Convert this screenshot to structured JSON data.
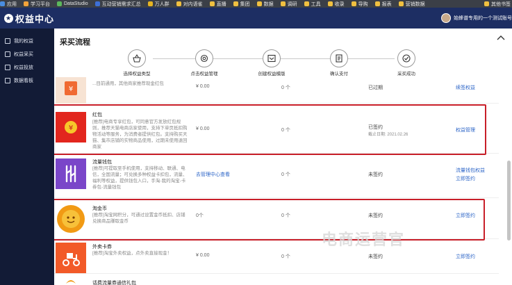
{
  "bookmarks": [
    {
      "label": "应用",
      "color": "#4a8de0"
    },
    {
      "label": "学习平台",
      "color": "#f2a33a"
    },
    {
      "label": "DataStudio",
      "color": "#5cb85c"
    },
    {
      "label": "互动营销需求汇总",
      "color": "#3d6fd6"
    },
    {
      "label": "万人群",
      "color": "#e6b422"
    },
    {
      "label": "对内语雀",
      "color": "#f0c040"
    },
    {
      "label": "直播",
      "color": "#f0c040"
    },
    {
      "label": "集团",
      "color": "#f0c040"
    },
    {
      "label": "数据",
      "color": "#f0c040"
    },
    {
      "label": "调研",
      "color": "#f0c040"
    },
    {
      "label": "工具",
      "color": "#f0c040"
    },
    {
      "label": "收录",
      "color": "#f0c040"
    },
    {
      "label": "导购",
      "color": "#f0c040"
    },
    {
      "label": "报表",
      "color": "#f0c040"
    },
    {
      "label": "营销数据",
      "color": "#f0c040"
    }
  ],
  "bookmarks_other": "其他书签",
  "app": {
    "title": "权益中心",
    "user": "始蜂谱专用的一个测试账号"
  },
  "sidebar": {
    "items": [
      {
        "label": "我的权益"
      },
      {
        "label": "权益采买"
      },
      {
        "label": "权益投放"
      },
      {
        "label": "数据看板"
      }
    ]
  },
  "main": {
    "title": "采买流程",
    "steps": [
      {
        "label": "选择权益类型",
        "icon": "basket-icon"
      },
      {
        "label": "点击权益管理",
        "icon": "gear-icon"
      },
      {
        "label": "创建权益模版",
        "icon": "template-icon"
      },
      {
        "label": "确认支付",
        "icon": "document-icon"
      },
      {
        "label": "采买成功",
        "icon": "check-icon"
      }
    ],
    "rows": [
      {
        "name": "",
        "desc": "...目前通用，其他商家推荐现金红包",
        "price": "¥ 0.00",
        "count": "0 个",
        "status": "已过期",
        "status_sub": "",
        "mid_link": "",
        "links": [
          "续签权益"
        ]
      },
      {
        "name": "红包",
        "desc": "[推荐]电商专享红包，可同意官方发放红包规则，推荐天猫电商店家使用，支持下单页抵扣购物活动等服务，为消费者提供红包。支持购买天猫、集市店铺的实物商品使用，过期未使用退回商家",
        "price": "¥ 0.00",
        "count": "0 个",
        "status": "已签约",
        "status_sub": "截止日期: 2021.02.26",
        "mid_link": "",
        "links": [
          "权益管理"
        ]
      },
      {
        "name": "流量钱包",
        "desc": "[推荐]可提取至手机使用，支持移动、联通、电信，全国流量；可兑换多种权益卡扣包，流量、福利等权益，提供钱包入口，手淘-我的淘宝-卡券包-流量钱包",
        "price": "",
        "count": "0 个",
        "status": "未签约",
        "status_sub": "",
        "mid_link": "去管理中心查看",
        "links": [
          "流量钱包权益",
          "立即签约"
        ]
      },
      {
        "name": "淘金币",
        "desc": "[推荐]淘宝网积分，可通过设置金币抵扣、店铺兑换商品赚取金币",
        "price": "0个",
        "count": "0 个",
        "status": "未签约",
        "status_sub": "",
        "mid_link": "",
        "links": [
          "立即签约"
        ]
      },
      {
        "name": "外卖卡券",
        "desc": "[推荐]淘宝外卖权益，点外卖直接现金！",
        "price": "¥ 0.00",
        "count": "0 个",
        "status": "未签约",
        "status_sub": "",
        "mid_link": "",
        "links": [
          "立即签约"
        ]
      },
      {
        "name": "话费流量券通信礼包",
        "desc": "",
        "price": "",
        "count": "",
        "status": "",
        "status_sub": "",
        "mid_link": "",
        "links": []
      }
    ]
  },
  "watermark": "电商运营官"
}
